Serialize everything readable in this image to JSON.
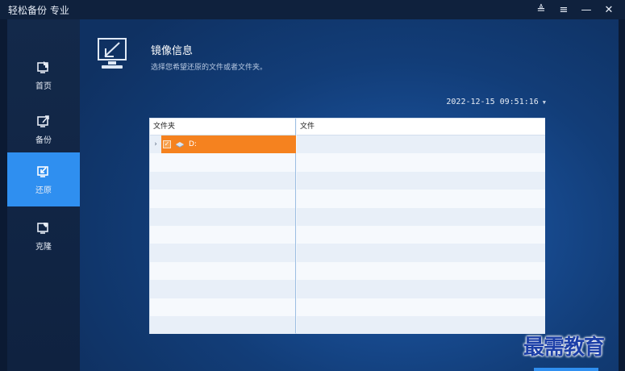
{
  "app": {
    "title": "轻松备份 专业"
  },
  "window_controls": [
    {
      "name": "upgrade-icon",
      "glyph": "≜"
    },
    {
      "name": "menu-icon",
      "glyph": "≡"
    },
    {
      "name": "minimize-icon",
      "glyph": "—"
    },
    {
      "name": "close-icon",
      "glyph": "✕"
    }
  ],
  "sidebar": {
    "items": [
      {
        "label": "首页",
        "icon": "home-icon",
        "active": false
      },
      {
        "label": "备份",
        "icon": "backup-icon",
        "active": false
      },
      {
        "label": "还原",
        "icon": "restore-icon",
        "active": true
      },
      {
        "label": "克隆",
        "icon": "clone-icon",
        "active": false
      }
    ]
  },
  "header": {
    "title": "镜像信息",
    "subtitle": "选择您希望还原的文件或者文件夹。",
    "icon": "image-restore-icon"
  },
  "date_select": {
    "value": "2022-12-15 09:51:16",
    "caret": "▼"
  },
  "table": {
    "columns": {
      "folder": "文件夹",
      "file": "文件"
    },
    "tree": [
      {
        "expander": "›",
        "checked": true,
        "check_glyph": "✓",
        "icon": "drive-icon",
        "label": "D:"
      }
    ]
  },
  "watermark": "最需教育",
  "colors": {
    "accent": "#2f8ff0",
    "selection": "#f5821f",
    "sidebar": "#13294a",
    "main_bg": "#174a8f"
  }
}
